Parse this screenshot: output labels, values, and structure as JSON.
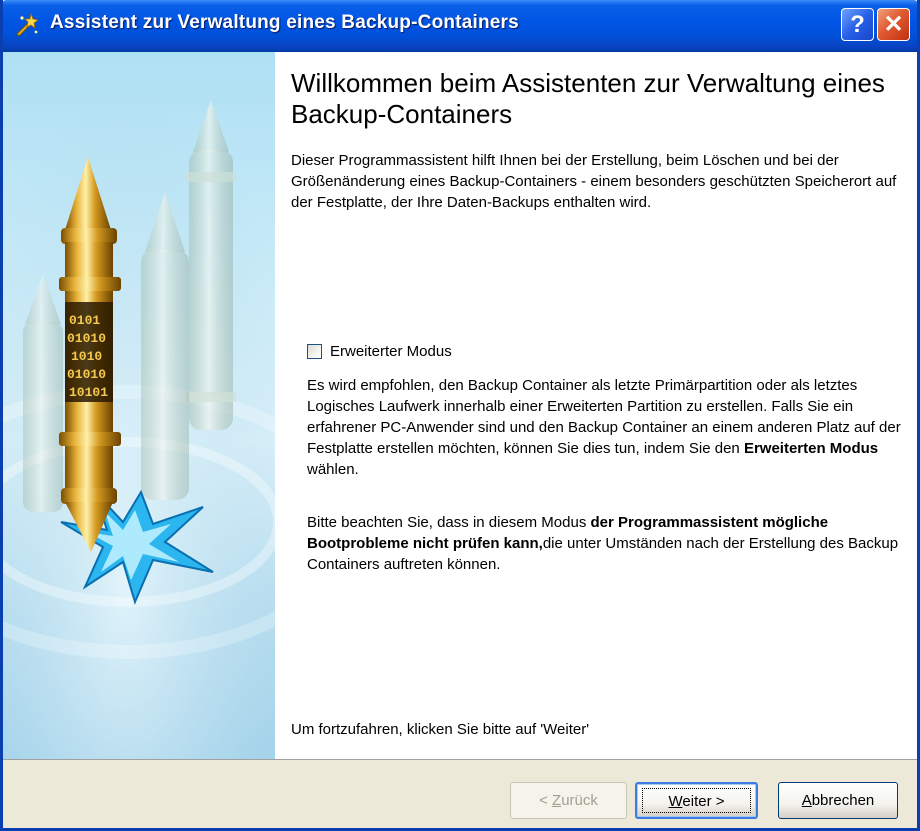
{
  "window": {
    "title": "Assistent zur Verwaltung eines Backup-Containers",
    "help_glyph": "?",
    "close_glyph": "✕"
  },
  "content": {
    "heading": "Willkommen beim Assistenten zur Verwaltung eines Backup-Containers",
    "intro": "Dieser Programmassistent hilft Ihnen bei der Erstellung, beim Löschen und bei der Größenänderung eines Backup-Containers - einem besonders geschützten Speicherort auf der Festplatte, der Ihre Daten-Backups enthalten wird.",
    "advanced_mode": {
      "label": "Erweiterter Modus",
      "checked": false
    },
    "paragraph1": {
      "text_before": "Es wird empfohlen, den Backup Container als letzte Primärpartition oder als letztes Logisches Laufwerk innerhalb einer Erweiterten Partition zu erstellen. Falls Sie ein erfahrener PC-Anwender sind und den Backup Container an einem anderen Platz auf der Festplatte erstellen möchten, können Sie dies tun, indem Sie den ",
      "bold": "Erweiterten Modus",
      "text_after": " wählen."
    },
    "paragraph2": {
      "text_before": "Bitte beachten Sie, dass in diesem Modus ",
      "bold": "der Programmassistent mögliche Bootprobleme nicht prüfen kann,",
      "text_after": "die unter Umständen nach der Erstellung des Backup Containers auftreten können."
    },
    "footer_hint": "Um fortzufahren, klicken Sie bitte auf 'Weiter'"
  },
  "side_art": {
    "binary_text": [
      "0101",
      "01010",
      "1010",
      "01010",
      "10101"
    ]
  },
  "buttons": {
    "back": {
      "prefix": "< ",
      "mnemonic": "Z",
      "rest": "urück",
      "enabled": false
    },
    "next": {
      "mnemonic": "W",
      "rest": "eiter >",
      "enabled": true
    },
    "cancel": {
      "mnemonic": "A",
      "rest": "bbrechen",
      "enabled": true
    }
  },
  "colors": {
    "title_bar": "#0054E3",
    "dialog_face": "#ECE9D8",
    "side_panel": "#C8EAF7",
    "gold": "#D4A017"
  }
}
